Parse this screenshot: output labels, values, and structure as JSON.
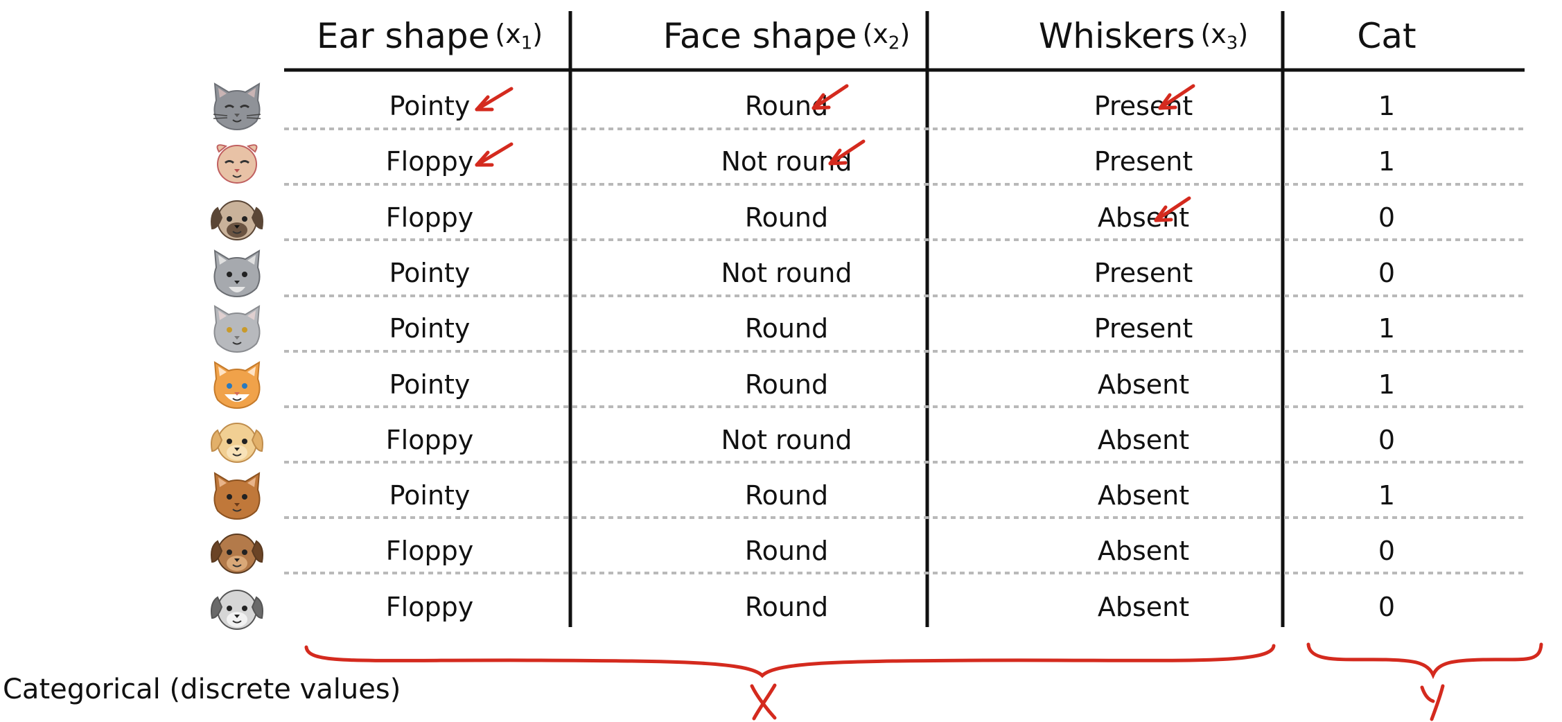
{
  "table": {
    "columns": [
      {
        "label": "Ear shape",
        "var": "x",
        "sub": "1"
      },
      {
        "label": "Face shape",
        "var": "x",
        "sub": "2"
      },
      {
        "label": "Whiskers",
        "var": "x",
        "sub": "3"
      },
      {
        "label": "Cat",
        "var": "",
        "sub": ""
      }
    ],
    "rows": [
      {
        "animal": "gray-cat-icon",
        "ear": "Pointy",
        "face": "Round",
        "whiskers": "Present",
        "cat": "1"
      },
      {
        "animal": "floppy-ear-cat-icon",
        "ear": "Floppy",
        "face": "Not round",
        "whiskers": "Present",
        "cat": "1"
      },
      {
        "animal": "pug-dog-icon",
        "ear": "Floppy",
        "face": "Round",
        "whiskers": "Absent",
        "cat": "0"
      },
      {
        "animal": "wolf-icon",
        "ear": "Pointy",
        "face": "Not round",
        "whiskers": "Present",
        "cat": "0"
      },
      {
        "animal": "silver-cat-icon",
        "ear": "Pointy",
        "face": "Round",
        "whiskers": "Present",
        "cat": "1"
      },
      {
        "animal": "orange-cat-icon",
        "ear": "Pointy",
        "face": "Round",
        "whiskers": "Absent",
        "cat": "1"
      },
      {
        "animal": "golden-dog-icon",
        "ear": "Floppy",
        "face": "Not round",
        "whiskers": "Absent",
        "cat": "0"
      },
      {
        "animal": "brown-cat-icon",
        "ear": "Pointy",
        "face": "Round",
        "whiskers": "Absent",
        "cat": "1"
      },
      {
        "animal": "brown-dog-icon",
        "ear": "Floppy",
        "face": "Round",
        "whiskers": "Absent",
        "cat": "0"
      },
      {
        "animal": "gray-dog-icon",
        "ear": "Floppy",
        "face": "Round",
        "whiskers": "Absent",
        "cat": "0"
      }
    ]
  },
  "annotations": {
    "features_brace_label": "X",
    "target_brace_label": "y",
    "bottom_caption": "Categorical (discrete values)",
    "arrow_color": "#d42a1e"
  },
  "colors": {
    "ink": "#111111",
    "dotted_rule": "#b9b9b9",
    "annotation_red": "#d42a1e"
  }
}
